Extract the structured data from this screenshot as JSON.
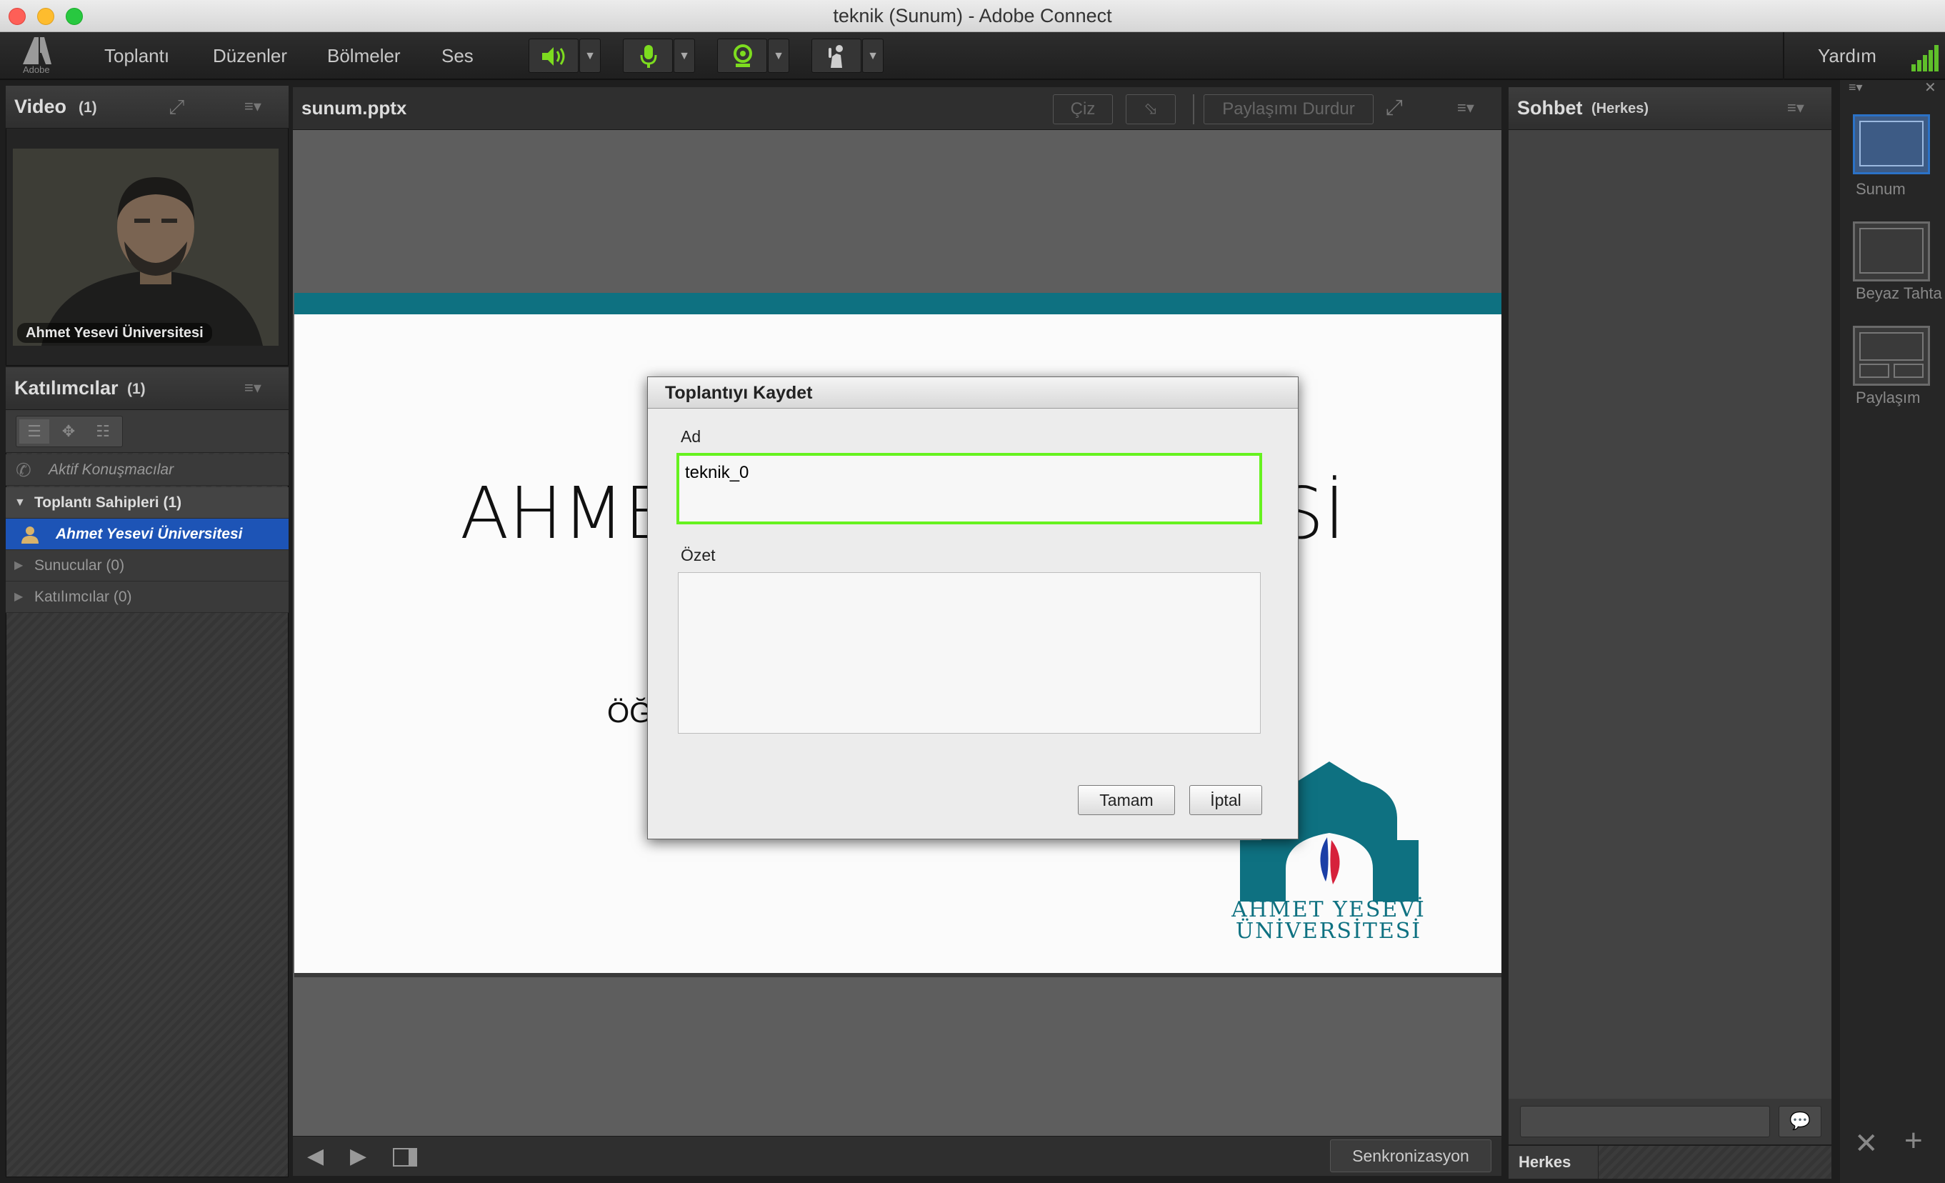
{
  "window": {
    "title": "teknik (Sunum) - Adobe Connect"
  },
  "menubar": {
    "logo_label": "Adobe",
    "items": [
      "Toplantı",
      "Düzenler",
      "Bölmeler",
      "Ses"
    ],
    "help": "Yardım",
    "icons": [
      "speaker-icon",
      "microphone-icon",
      "webcam-icon",
      "raise-hand-icon"
    ],
    "accent": "#7ddc1f"
  },
  "video_pod": {
    "title": "Video",
    "count": "(1)",
    "participant_name": "Ahmet Yesevi Üniversitesi"
  },
  "attendees_pod": {
    "title": "Katılımcılar",
    "count": "(1)",
    "active_speakers": "Aktif Konuşmacılar",
    "hosts_group": "Toplantı Sahipleri (1)",
    "host_name": "Ahmet Yesevi Üniversitesi",
    "presenters_group": "Sunucular (0)",
    "participants_group": "Katılımcılar (0)",
    "selected_color": "#1d54b6"
  },
  "share_pod": {
    "filename": "sunum.pptx",
    "draw_button": "Çiz",
    "stop_sharing_button": "Paylaşımı Durdur",
    "sync_button": "Senkronizasyon",
    "slide": {
      "title_left": "AHME",
      "title_right": "Sİ",
      "subtitle_fragment": "ÖĞ",
      "logo_line1": "AHMET YESEVİ",
      "logo_line2": "ÜNİVERSİTESİ",
      "brand_color": "#0e7181"
    }
  },
  "chat_pod": {
    "title": "Sohbet",
    "scope": "(Herkes)",
    "tab_everyone": "Herkes",
    "input_value": ""
  },
  "layouts": {
    "items": [
      {
        "label": "Sunum",
        "selected": true
      },
      {
        "label": "Beyaz Tahta",
        "selected": false
      },
      {
        "label": "Paylaşım",
        "selected": false
      }
    ]
  },
  "dialog": {
    "title": "Toplantıyı Kaydet",
    "name_label": "Ad",
    "name_value": "teknik_0",
    "summary_label": "Özet",
    "summary_value": "",
    "ok_button": "Tamam",
    "cancel_button": "İptal",
    "focus_color": "#66f21f"
  }
}
